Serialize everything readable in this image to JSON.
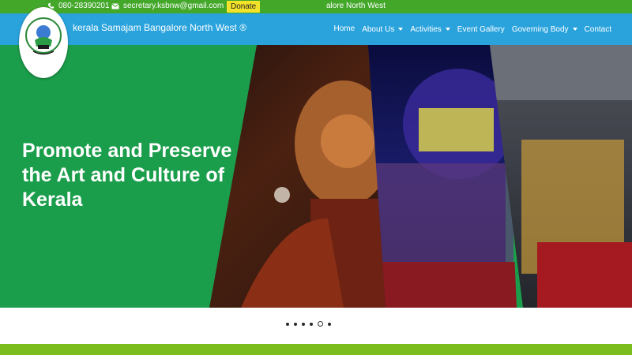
{
  "topbar": {
    "phone": "080-28390201",
    "email": "secretary.ksbnw@gmail.com",
    "donate_label": "Donate",
    "marquee_text": "alore North West"
  },
  "navbar": {
    "brand": "kerala Samajam Bangalore North West ®",
    "links": [
      {
        "label": "Home",
        "dropdown": false,
        "active": true
      },
      {
        "label": "About Us",
        "dropdown": true
      },
      {
        "label": "Activities",
        "dropdown": true
      },
      {
        "label": "Event Gallery",
        "dropdown": false
      },
      {
        "label": "Governing Body",
        "dropdown": true
      },
      {
        "label": "Contact",
        "dropdown": false
      }
    ]
  },
  "hero": {
    "title": "Promote and Preserve the Art and Culture of Kerala"
  },
  "carousel": {
    "slide_count": 6,
    "active_index": 4
  },
  "colors": {
    "topbar": "#43a72a",
    "navbar": "#2aa3dd",
    "hero_green": "#1b9e4b",
    "donate": "#f2e22a",
    "footer_strip": "#7cbd1e"
  },
  "icons": {
    "phone": "phone-icon",
    "email": "envelope-icon",
    "dropdown": "caret-down-icon"
  }
}
